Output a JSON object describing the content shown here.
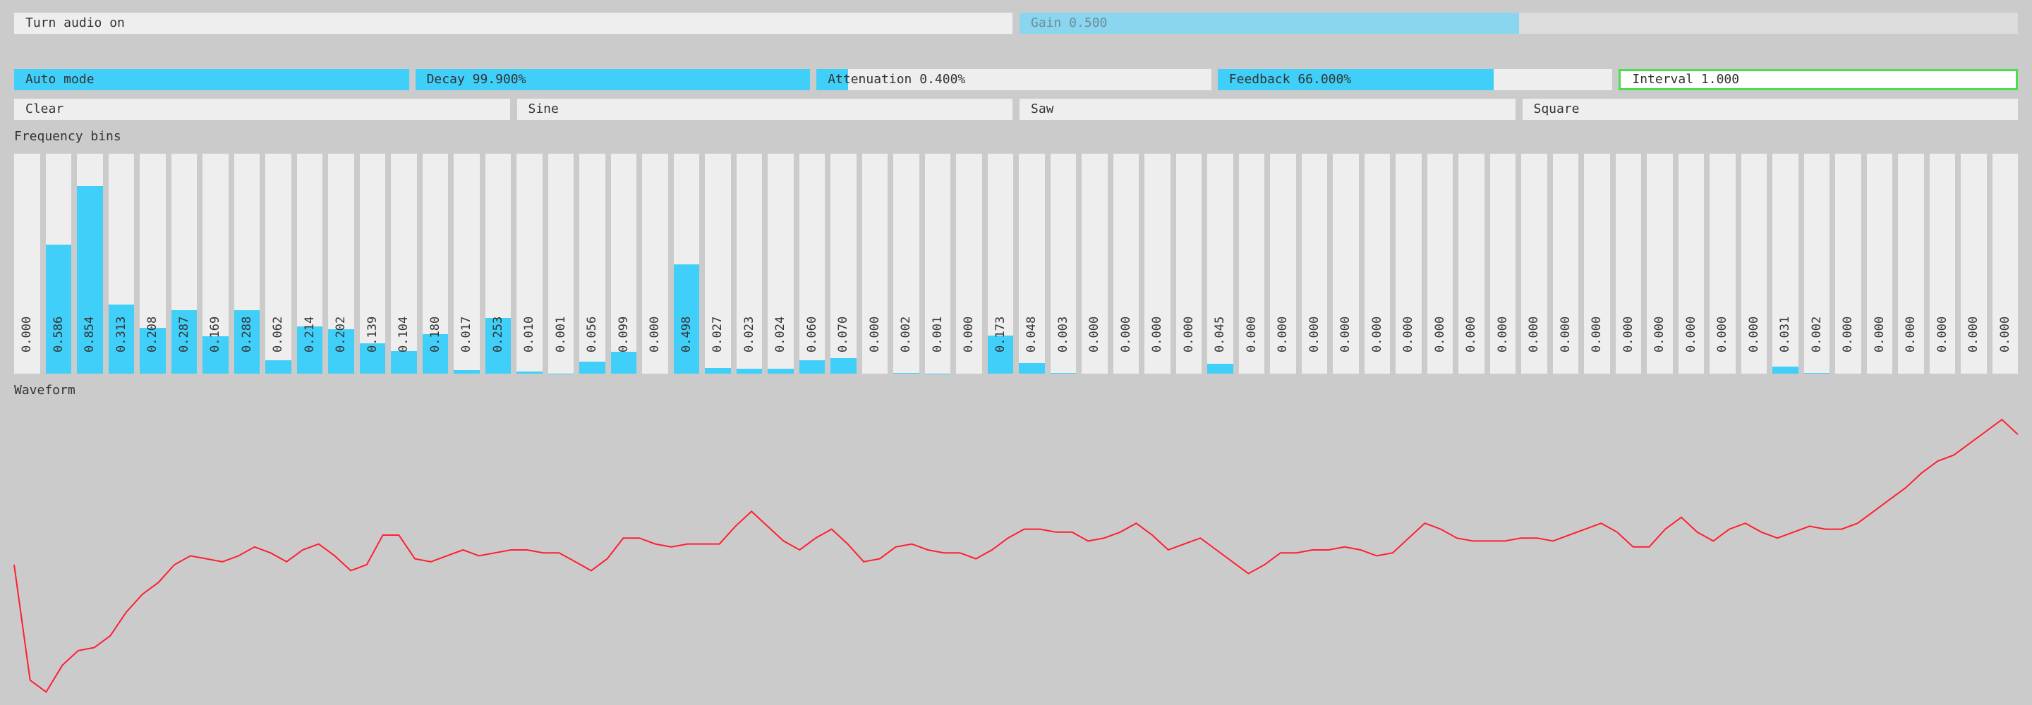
{
  "audio": {
    "toggle_label": "Turn audio on",
    "gain_label": "Gain 0.500",
    "gain_value": 0.5
  },
  "controls": {
    "auto_mode": {
      "label": "Auto mode",
      "value": 1.0
    },
    "decay": {
      "label": "Decay 99.900%",
      "value": 0.999
    },
    "attenuation": {
      "label": "Attenuation 0.400%",
      "value": 0.08
    },
    "feedback": {
      "label": "Feedback 66.000%",
      "value": 0.7
    },
    "interval": {
      "label": "Interval 1.000"
    }
  },
  "buttons": {
    "clear": "Clear",
    "sine": "Sine",
    "saw": "Saw",
    "square": "Square"
  },
  "frequency": {
    "title": "Frequency bins",
    "bins": [
      0.0,
      0.586,
      0.854,
      0.313,
      0.208,
      0.287,
      0.169,
      0.288,
      0.062,
      0.214,
      0.202,
      0.139,
      0.104,
      0.18,
      0.017,
      0.253,
      0.01,
      0.001,
      0.056,
      0.099,
      0.0,
      0.498,
      0.027,
      0.023,
      0.024,
      0.06,
      0.07,
      0.0,
      0.002,
      0.001,
      0.0,
      0.173,
      0.048,
      0.003,
      0.0,
      0.0,
      0.0,
      0.0,
      0.045,
      0.0,
      0.0,
      0.0,
      0.0,
      0.0,
      0.0,
      0.0,
      0.0,
      0.0,
      0.0,
      0.0,
      0.0,
      0.0,
      0.0,
      0.0,
      0.0,
      0.0,
      0.031,
      0.002,
      0.0,
      0.0,
      0.0,
      0.0,
      0.0,
      0.0
    ]
  },
  "waveform": {
    "title": "Waveform",
    "color": "#ff1f2f",
    "samples": [
      0.45,
      0.06,
      0.02,
      0.11,
      0.16,
      0.17,
      0.21,
      0.29,
      0.35,
      0.39,
      0.45,
      0.48,
      0.47,
      0.46,
      0.48,
      0.51,
      0.49,
      0.46,
      0.5,
      0.52,
      0.48,
      0.43,
      0.45,
      0.55,
      0.55,
      0.47,
      0.46,
      0.48,
      0.5,
      0.48,
      0.49,
      0.5,
      0.5,
      0.49,
      0.49,
      0.46,
      0.43,
      0.47,
      0.54,
      0.54,
      0.52,
      0.51,
      0.52,
      0.52,
      0.52,
      0.58,
      0.63,
      0.58,
      0.53,
      0.5,
      0.54,
      0.57,
      0.52,
      0.46,
      0.47,
      0.51,
      0.52,
      0.5,
      0.49,
      0.49,
      0.47,
      0.5,
      0.54,
      0.57,
      0.57,
      0.56,
      0.56,
      0.53,
      0.54,
      0.56,
      0.59,
      0.55,
      0.5,
      0.52,
      0.54,
      0.5,
      0.46,
      0.42,
      0.45,
      0.49,
      0.49,
      0.5,
      0.5,
      0.51,
      0.5,
      0.48,
      0.49,
      0.54,
      0.59,
      0.57,
      0.54,
      0.53,
      0.53,
      0.53,
      0.54,
      0.54,
      0.53,
      0.55,
      0.57,
      0.59,
      0.56,
      0.51,
      0.51,
      0.57,
      0.61,
      0.56,
      0.53,
      0.57,
      0.59,
      0.56,
      0.54,
      0.56,
      0.58,
      0.57,
      0.57,
      0.59,
      0.63,
      0.67,
      0.71,
      0.76,
      0.8,
      0.82,
      0.86,
      0.9,
      0.94,
      0.89
    ]
  }
}
